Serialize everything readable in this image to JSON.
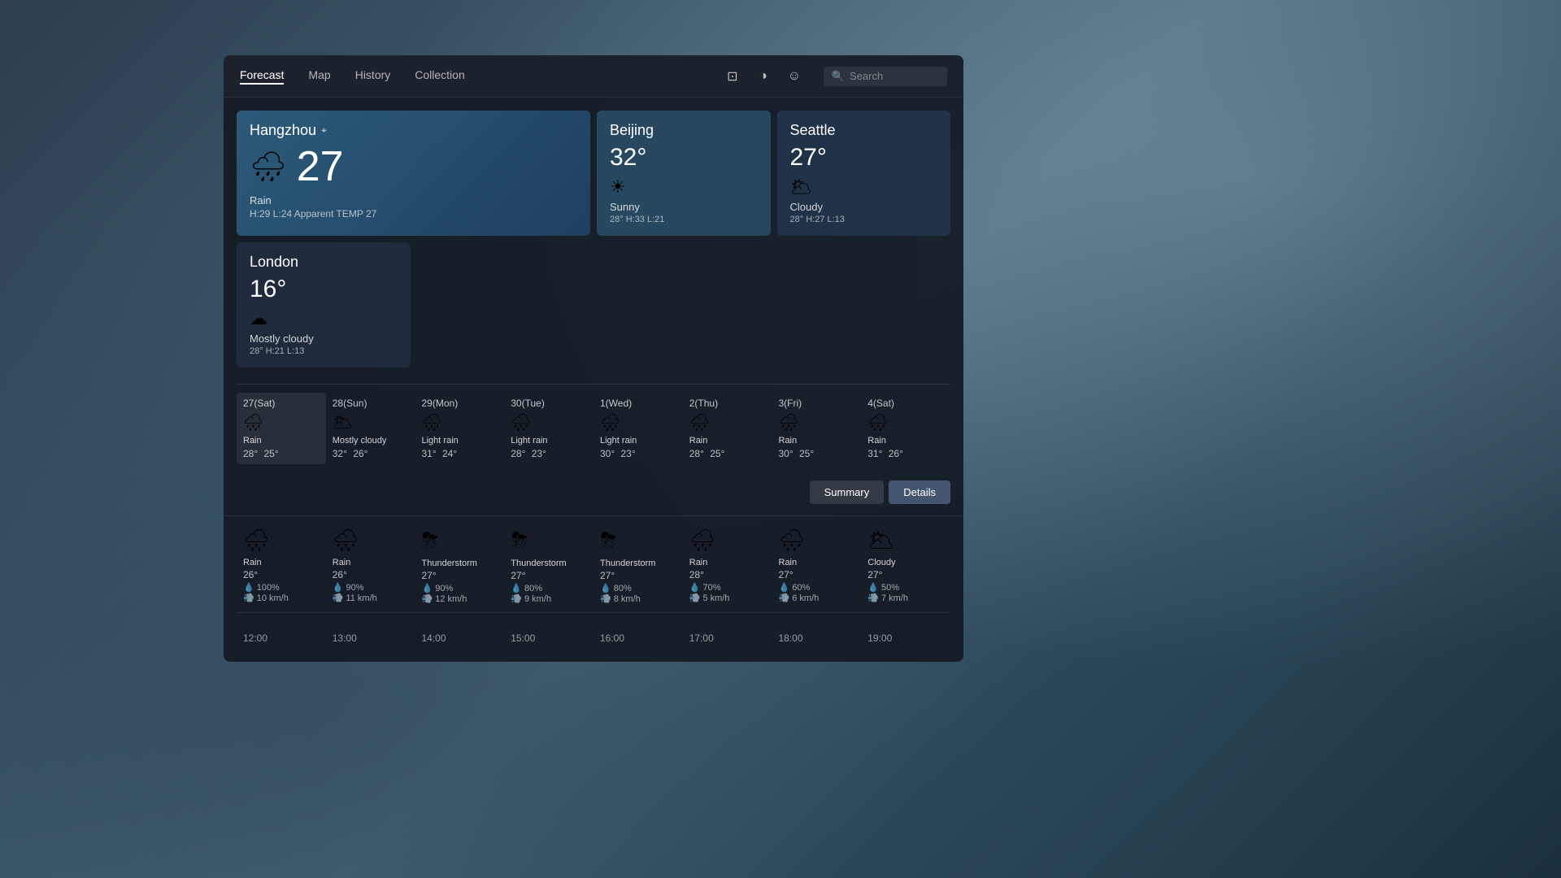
{
  "nav": {
    "tabs": [
      {
        "id": "forecast",
        "label": "Forecast",
        "active": true
      },
      {
        "id": "map",
        "label": "Map",
        "active": false
      },
      {
        "id": "history",
        "label": "History",
        "active": false
      },
      {
        "id": "collection",
        "label": "Collection",
        "active": false
      }
    ],
    "search_placeholder": "Search"
  },
  "cities": {
    "main": {
      "name": "Hangzhou",
      "has_location": true,
      "temp": "27",
      "icon": "🌧",
      "description": "Rain",
      "detail": "H:29 L:24 Apparent TEMP 27"
    },
    "secondary": [
      {
        "id": "beijing",
        "name": "Beijing",
        "temp": "32°",
        "icon": "☀",
        "description": "Sunny",
        "detail": "28° H:33 L:21"
      },
      {
        "id": "seattle",
        "name": "Seattle",
        "temp": "27°",
        "icon": "🌥",
        "description": "Cloudy",
        "detail": "28° H:27 L:13"
      },
      {
        "id": "london",
        "name": "London",
        "temp": "16°",
        "icon": "☁",
        "description": "Mostly cloudy",
        "detail": "28° H:21 L:13"
      }
    ]
  },
  "weekly": [
    {
      "day": "27(Sat)",
      "icon": "🌧",
      "desc": "Rain",
      "high": "28°",
      "low": "25°",
      "today": true
    },
    {
      "day": "28(Sun)",
      "icon": "🌥",
      "desc": "Mostly cloudy",
      "high": "32°",
      "low": "26°",
      "today": false
    },
    {
      "day": "29(Mon)",
      "icon": "🌧",
      "desc": "Light rain",
      "high": "31°",
      "low": "24°",
      "today": false
    },
    {
      "day": "30(Tue)",
      "icon": "🌧",
      "desc": "Light rain",
      "high": "28°",
      "low": "23°",
      "today": false
    },
    {
      "day": "1(Wed)",
      "icon": "🌧",
      "desc": "Light rain",
      "high": "30°",
      "low": "23°",
      "today": false
    },
    {
      "day": "2(Thu)",
      "icon": "🌧",
      "desc": "Rain",
      "high": "28°",
      "low": "25°",
      "today": false
    },
    {
      "day": "3(Fri)",
      "icon": "🌧",
      "desc": "Rain",
      "high": "30°",
      "low": "25°",
      "today": false
    },
    {
      "day": "4(Sat)",
      "icon": "🌧",
      "desc": "Rain",
      "high": "31°",
      "low": "26°",
      "today": false
    }
  ],
  "actions": {
    "summary": "Summary",
    "details": "Details"
  },
  "hourly": [
    {
      "time": "12:00",
      "icon": "🌧",
      "desc": "Rain",
      "temp": "26°",
      "precip": "100%",
      "wind": "10 km/h"
    },
    {
      "time": "13:00",
      "icon": "🌧",
      "desc": "Rain",
      "temp": "26°",
      "precip": "90%",
      "wind": "11 km/h"
    },
    {
      "time": "14:00",
      "icon": "⛈",
      "desc": "Thunderstorm",
      "temp": "27°",
      "precip": "90%",
      "wind": "12 km/h"
    },
    {
      "time": "15:00",
      "icon": "⛈",
      "desc": "Thunderstorm",
      "temp": "27°",
      "precip": "80%",
      "wind": "9 km/h"
    },
    {
      "time": "16:00",
      "icon": "⛈",
      "desc": "Thunderstorm",
      "temp": "27°",
      "precip": "80%",
      "wind": "8 km/h"
    },
    {
      "time": "17:00",
      "icon": "🌧",
      "desc": "Rain",
      "temp": "28°",
      "precip": "70%",
      "wind": "5 km/h"
    },
    {
      "time": "18:00",
      "icon": "🌧",
      "desc": "Rain",
      "temp": "27°",
      "precip": "60%",
      "wind": "6 km/h"
    },
    {
      "time": "19:00",
      "icon": "🌥",
      "desc": "Cloudy",
      "temp": "27°",
      "precip": "50%",
      "wind": "7 km/h"
    }
  ]
}
